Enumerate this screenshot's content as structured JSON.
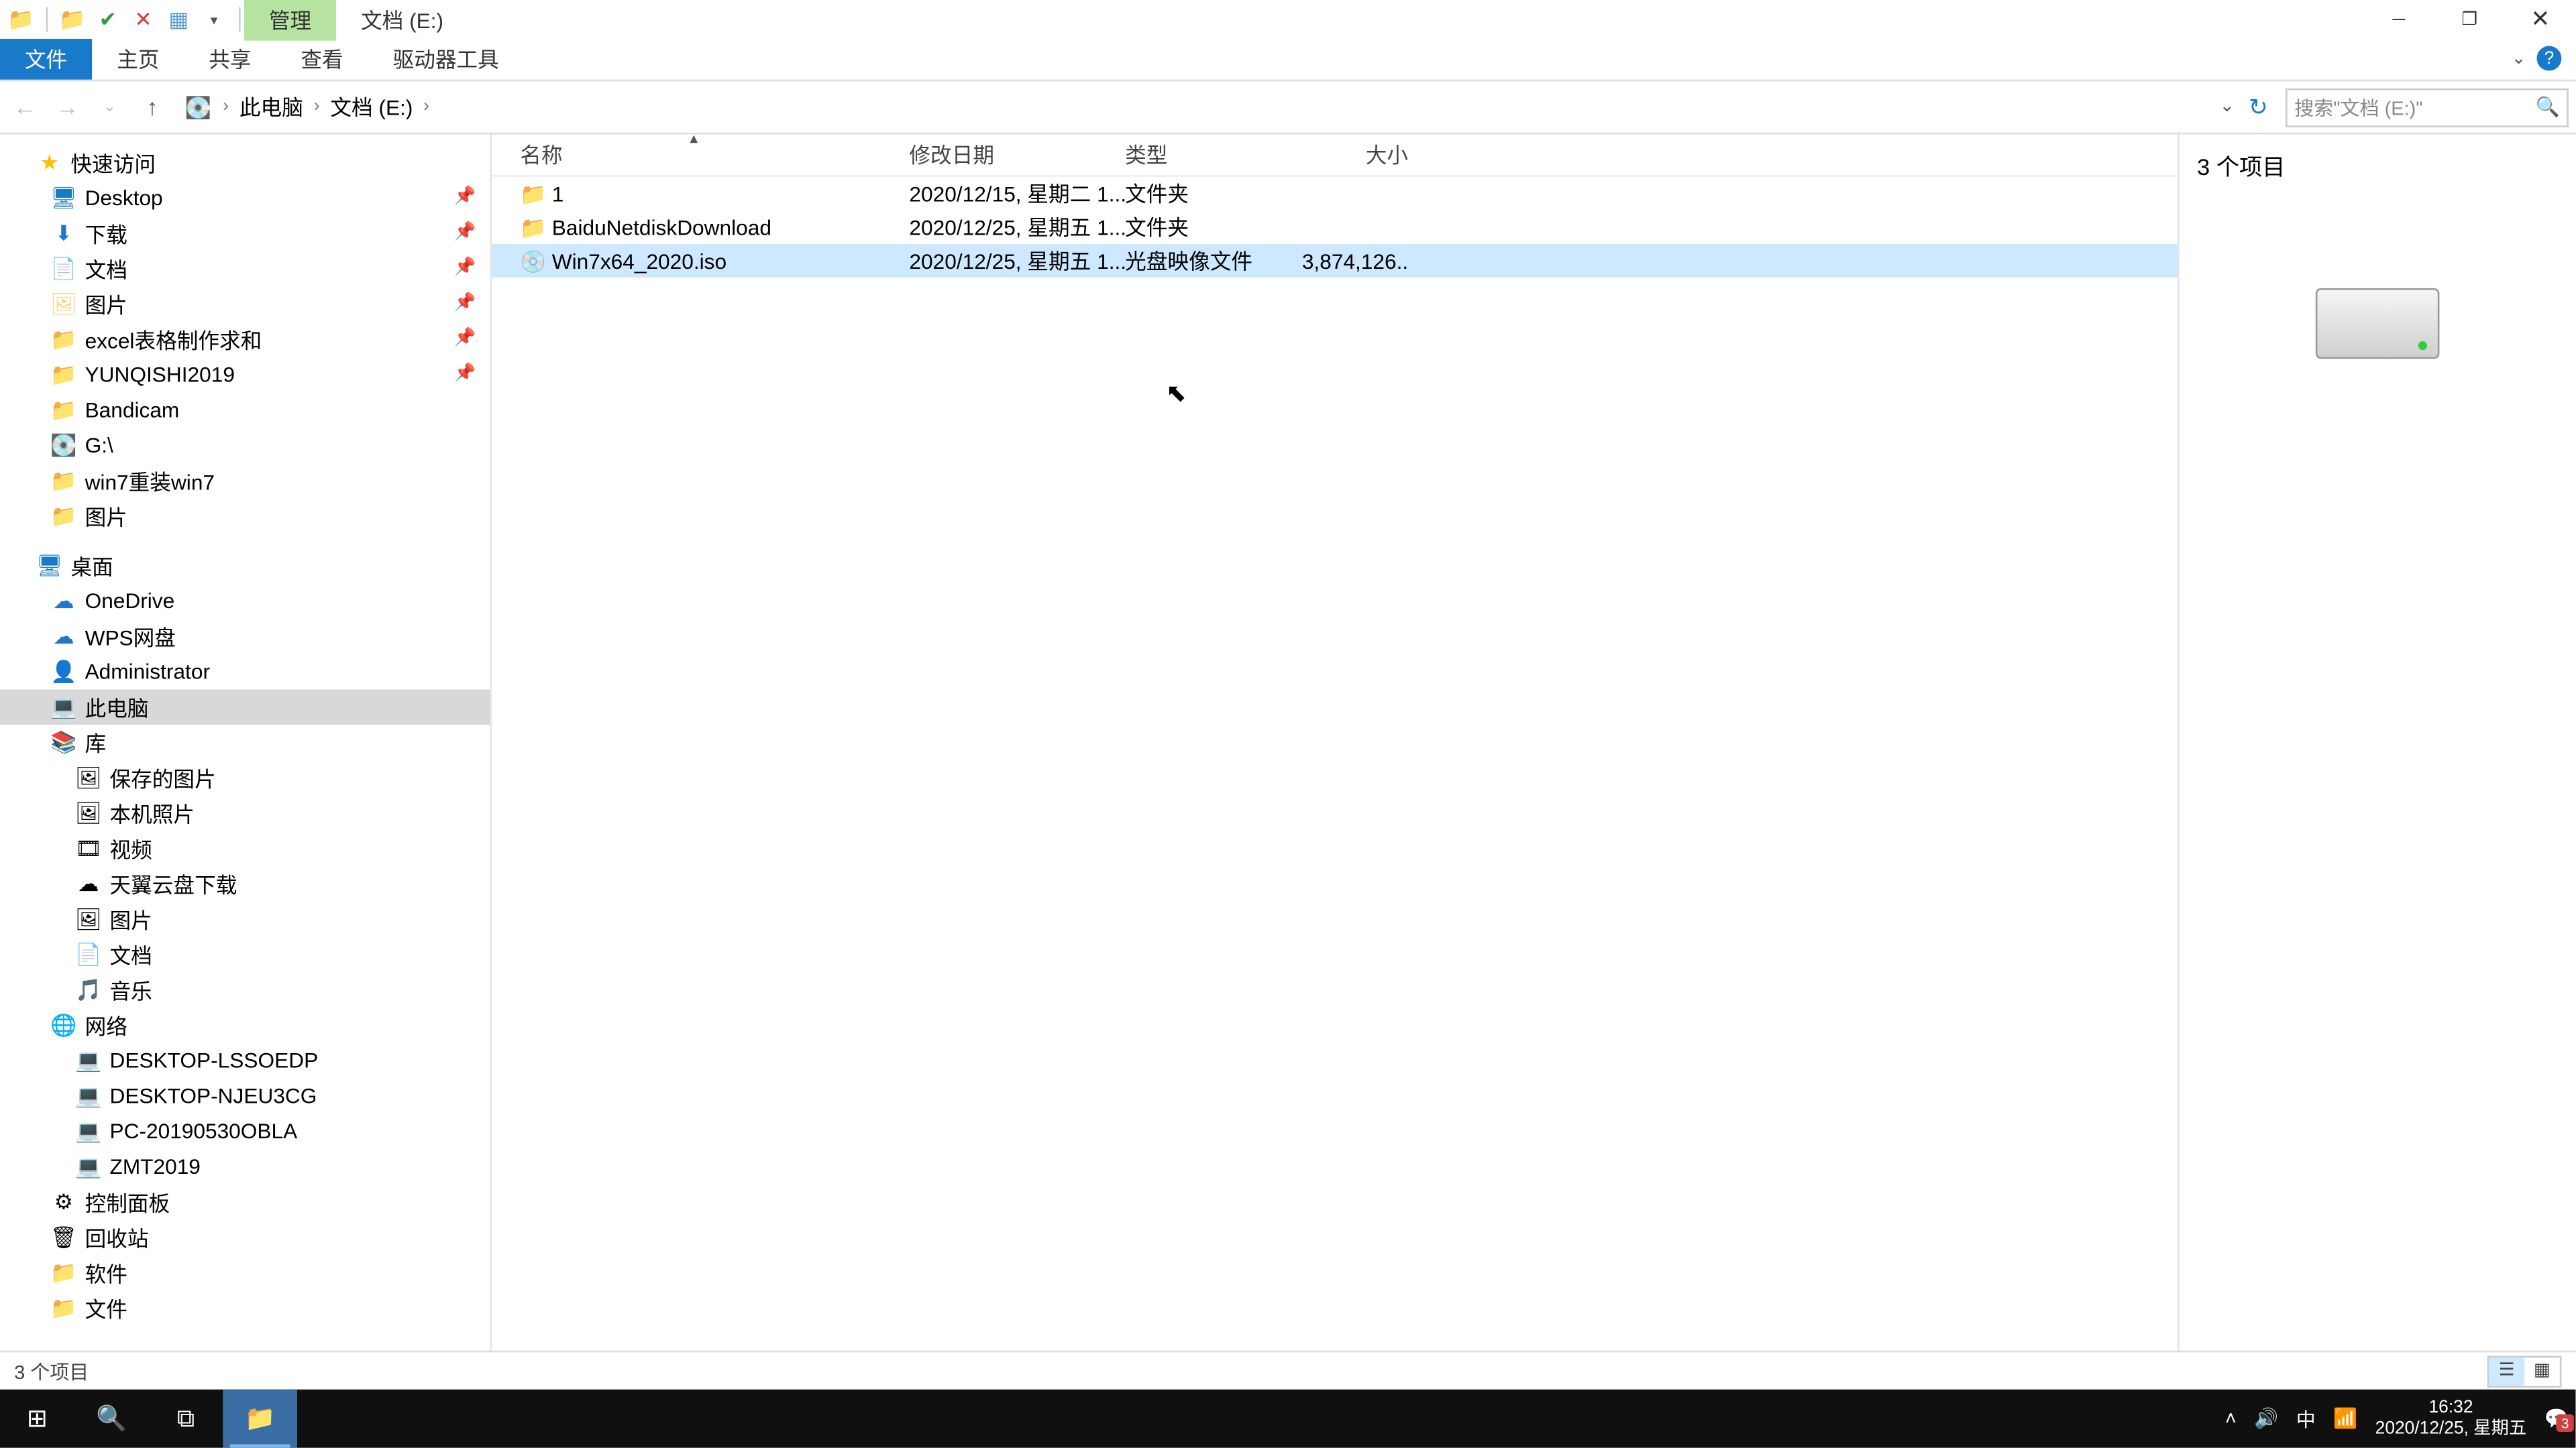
{
  "titlebar": {
    "context_tab": "管理",
    "location_tab": "文档 (E:)"
  },
  "ribbon": {
    "file": "文件",
    "home": "主页",
    "share": "共享",
    "view": "查看",
    "drive_tools": "驱动器工具"
  },
  "breadcrumb": {
    "root": "此电脑",
    "current": "文档 (E:)"
  },
  "search": {
    "placeholder": "搜索\"文档 (E:)\""
  },
  "sidebar": {
    "quick_access": "快速访问",
    "desktop": "Desktop",
    "downloads": "下载",
    "documents": "文档",
    "pictures": "图片",
    "excel": "excel表格制作求和",
    "yunqi": "YUNQISHI2019",
    "bandicam": "Bandicam",
    "gdrive": "G:\\",
    "win7": "win7重装win7",
    "pictures2": "图片",
    "desktop2": "桌面",
    "onedrive": "OneDrive",
    "wps": "WPS网盘",
    "admin": "Administrator",
    "thispc": "此电脑",
    "library": "库",
    "saved_pics": "保存的图片",
    "camera_roll": "本机照片",
    "videos": "视频",
    "tianyi": "天翼云盘下载",
    "pics3": "图片",
    "docs3": "文档",
    "music": "音乐",
    "network": "网络",
    "pc1": "DESKTOP-LSSOEDP",
    "pc2": "DESKTOP-NJEU3CG",
    "pc3": "PC-20190530OBLA",
    "pc4": "ZMT2019",
    "control": "控制面板",
    "recycle": "回收站",
    "software": "软件",
    "files": "文件"
  },
  "columns": {
    "name": "名称",
    "date": "修改日期",
    "type": "类型",
    "size": "大小"
  },
  "rows": [
    {
      "name": "1",
      "date": "2020/12/15, 星期二 1...",
      "type": "文件夹",
      "size": "",
      "icon": "folder"
    },
    {
      "name": "BaiduNetdiskDownload",
      "date": "2020/12/25, 星期五 1...",
      "type": "文件夹",
      "size": "",
      "icon": "folder"
    },
    {
      "name": "Win7x64_2020.iso",
      "date": "2020/12/25, 星期五 1...",
      "type": "光盘映像文件",
      "size": "3,874,126...",
      "icon": "disc",
      "selected": true
    }
  ],
  "preview": {
    "count": "3 个项目"
  },
  "status": {
    "text": "3 个项目"
  },
  "tray": {
    "ime": "中",
    "time": "16:32",
    "date": "2020/12/25, 星期五",
    "notifications": "3"
  }
}
